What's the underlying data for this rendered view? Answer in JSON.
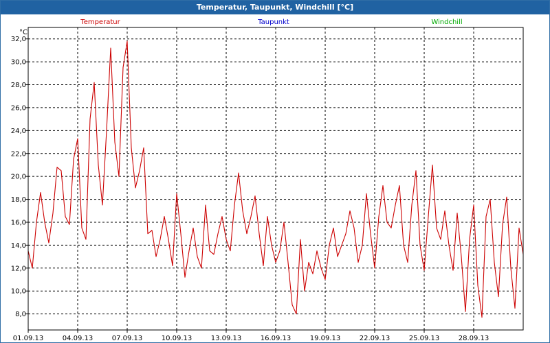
{
  "window": {
    "title": "Temperatur, Taupunkt, Windchill [°C]"
  },
  "colors": {
    "titlebar": "#2062a2",
    "temperatur": "#cc0000",
    "taupunkt": "#0000cc",
    "windchill": "#00aa00",
    "grid": "#000000"
  },
  "chart_data": {
    "type": "line",
    "title": "Temperatur, Taupunkt, Windchill [°C]",
    "ylabel": "°C",
    "ylim": [
      6.6,
      33.0
    ],
    "xlim": [
      0,
      30
    ],
    "grid": true,
    "legend_placement": "top",
    "x_tick_positions": [
      0,
      3,
      6,
      9,
      12,
      15,
      18,
      21,
      24,
      27
    ],
    "x_ticks": [
      "01.09.13",
      "04.09.13",
      "07.09.13",
      "10.09.13",
      "13.09.13",
      "16.09.13",
      "19.09.13",
      "22.09.13",
      "25.09.13",
      "28.09.13"
    ],
    "y_tick_values": [
      8,
      10,
      12,
      14,
      16,
      18,
      20,
      22,
      24,
      26,
      28,
      30,
      32
    ],
    "y_ticks": [
      "8,0",
      "10,0",
      "12,0",
      "14,0",
      "16,0",
      "18,0",
      "20,0",
      "22,0",
      "24,0",
      "26,0",
      "28,0",
      "30,0",
      "32,0"
    ],
    "series": [
      {
        "name": "Temperatur",
        "color": "#cc0000",
        "x": [
          0.0,
          0.25,
          0.5,
          0.75,
          1.0,
          1.25,
          1.5,
          1.75,
          2.0,
          2.25,
          2.5,
          2.75,
          3.0,
          3.25,
          3.5,
          3.75,
          4.0,
          4.25,
          4.5,
          4.75,
          5.0,
          5.25,
          5.5,
          5.75,
          6.0,
          6.25,
          6.5,
          6.75,
          7.0,
          7.25,
          7.5,
          7.75,
          8.0,
          8.25,
          8.5,
          8.75,
          9.0,
          9.25,
          9.5,
          9.75,
          10.0,
          10.25,
          10.5,
          10.75,
          11.0,
          11.25,
          11.5,
          11.75,
          12.0,
          12.25,
          12.5,
          12.75,
          13.0,
          13.25,
          13.5,
          13.75,
          14.0,
          14.25,
          14.5,
          14.75,
          15.0,
          15.25,
          15.5,
          15.75,
          16.0,
          16.25,
          16.5,
          16.75,
          17.0,
          17.25,
          17.5,
          17.75,
          18.0,
          18.25,
          18.5,
          18.75,
          19.0,
          19.25,
          19.5,
          19.75,
          20.0,
          20.25,
          20.5,
          20.75,
          21.0,
          21.25,
          21.5,
          21.75,
          22.0,
          22.25,
          22.5,
          22.75,
          23.0,
          23.25,
          23.5,
          23.75,
          24.0,
          24.25,
          24.5,
          24.75,
          25.0,
          25.25,
          25.5,
          25.75,
          26.0,
          26.25,
          26.5,
          26.75,
          27.0,
          27.25,
          27.5,
          27.75,
          28.0,
          28.25,
          28.5,
          28.75,
          29.0,
          29.25,
          29.5,
          29.75,
          30.0
        ],
        "y": [
          13.5,
          12.0,
          16.0,
          18.6,
          16.0,
          14.2,
          16.8,
          20.8,
          20.5,
          16.5,
          15.8,
          21.5,
          23.3,
          15.5,
          14.5,
          25.0,
          28.2,
          21.0,
          17.5,
          24.0,
          31.2,
          23.0,
          20.0,
          29.5,
          31.8,
          22.5,
          19.0,
          20.5,
          22.5,
          15.0,
          15.3,
          13.0,
          14.5,
          16.5,
          14.5,
          12.2,
          18.5,
          15.0,
          11.2,
          13.5,
          15.5,
          13.0,
          12.0,
          17.5,
          13.5,
          13.2,
          15.0,
          16.5,
          14.5,
          13.5,
          17.5,
          20.3,
          17.0,
          15.0,
          16.5,
          18.3,
          15.0,
          12.2,
          16.5,
          14.0,
          12.5,
          13.5,
          16.0,
          12.5,
          8.8,
          8.0,
          14.5,
          10.0,
          12.5,
          11.5,
          13.5,
          12.0,
          11.0,
          14.0,
          15.5,
          13.0,
          14.0,
          15.0,
          17.0,
          15.5,
          12.5,
          14.0,
          18.5,
          15.0,
          12.0,
          16.5,
          19.2,
          16.0,
          15.5,
          17.5,
          19.2,
          14.0,
          12.5,
          17.5,
          20.5,
          14.0,
          11.8,
          16.5,
          21.0,
          15.5,
          14.5,
          17.0,
          14.0,
          11.8,
          16.8,
          13.0,
          8.2,
          14.5,
          17.5,
          10.5,
          7.7,
          16.5,
          18.0,
          12.5,
          9.5,
          15.8,
          18.2,
          12.0,
          8.5,
          15.5,
          13.2
        ]
      },
      {
        "name": "Taupunkt",
        "color": "#0000cc",
        "x": [],
        "y": []
      },
      {
        "name": "Windchill",
        "color": "#00aa00",
        "x": [],
        "y": []
      }
    ]
  }
}
